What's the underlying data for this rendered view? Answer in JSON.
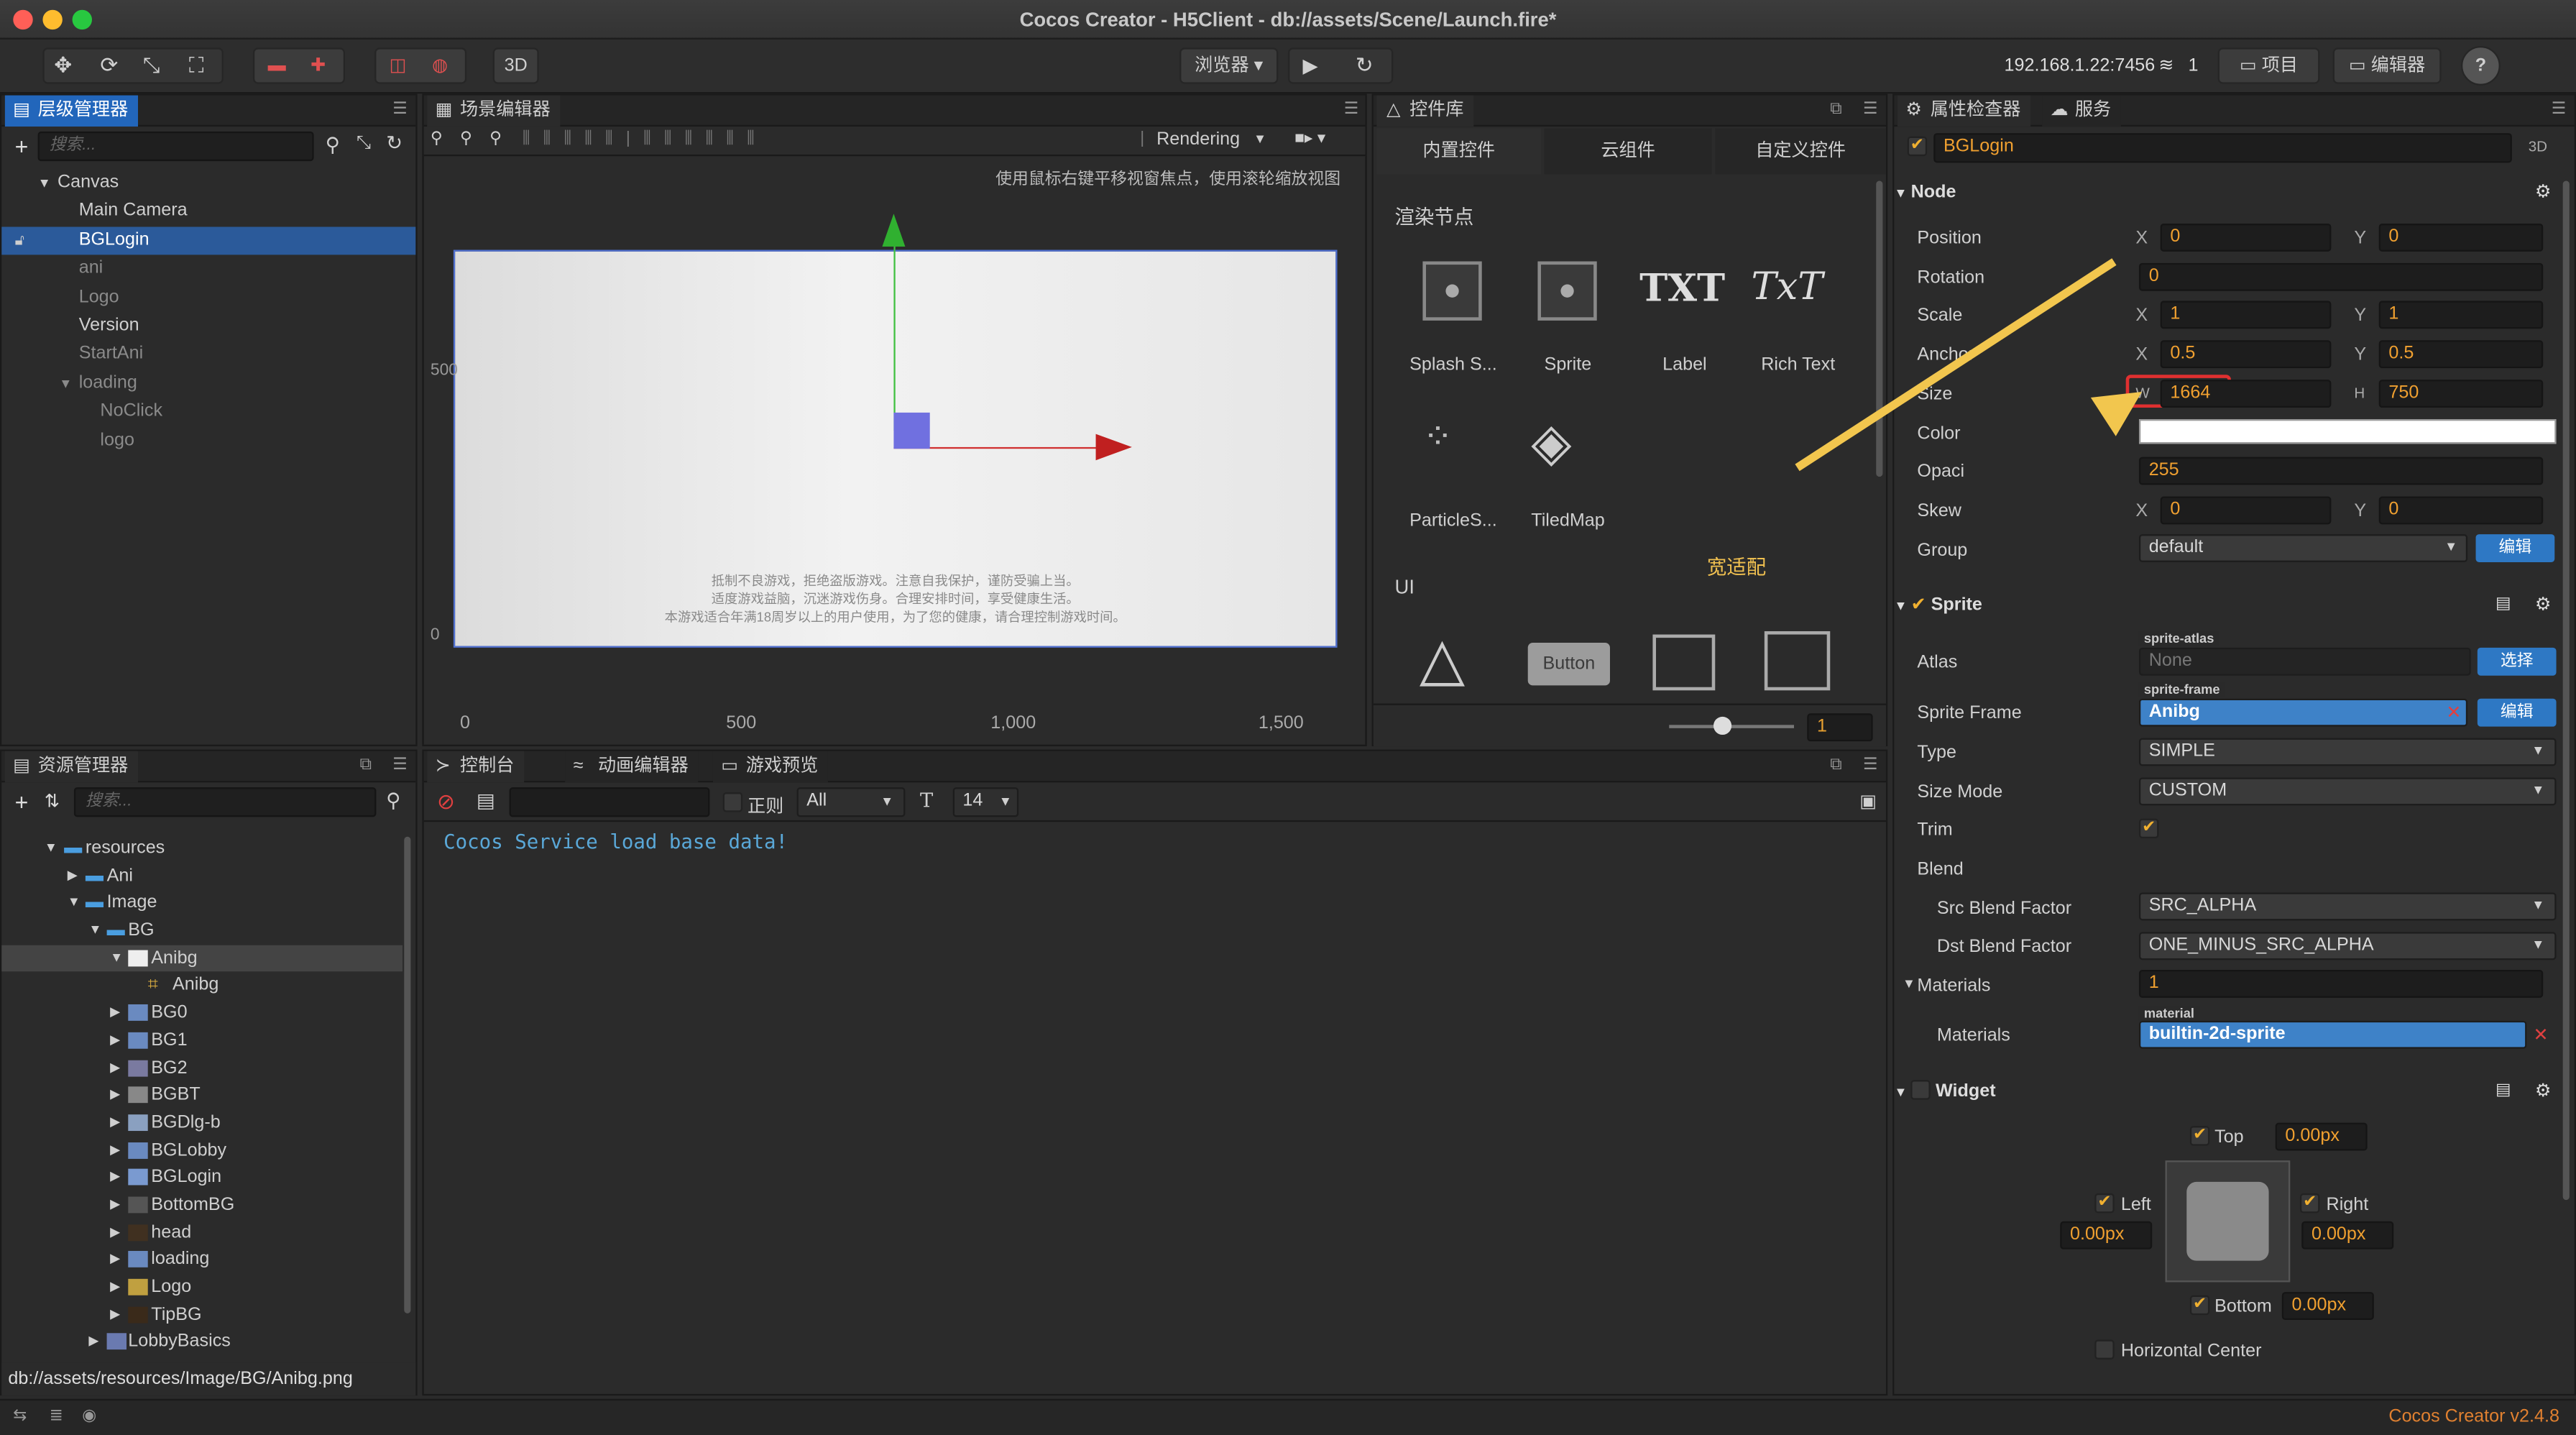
{
  "window": {
    "title": "Cocos Creator - H5Client - db://assets/Scene/Launch.fire*"
  },
  "toolbar": {
    "ip": "192.168.1.22:7456",
    "count": "1",
    "browser": "浏览器 ▾",
    "project": "项目",
    "editor": "编辑器",
    "btn_3d": "3D",
    "help": "?"
  },
  "hierarchy": {
    "tab": "层级管理器",
    "search_placeholder": "搜索...",
    "nodes": [
      "Canvas",
      "Main Camera",
      "BGLogin",
      "ani",
      "Logo",
      "Version",
      "StartAni",
      "loading",
      "NoClick",
      "logo"
    ]
  },
  "scene": {
    "tab": "场景编辑器",
    "rendering": "Rendering",
    "hint": "使用鼠标右键平移视窗焦点，使用滚轮缩放视图",
    "y500": "500",
    "y0": "0",
    "x_ticks": [
      "0",
      "500",
      "1,000",
      "1,500"
    ],
    "canvas_text": [
      "抵制不良游戏，拒绝盗版游戏。注意自我保护，谨防受骗上当。",
      "适度游戏益脑，沉迷游戏伤身。合理安排时间，享受健康生活。",
      "本游戏适合年满18周岁以上的用户使用，为了您的健康，请合理控制游戏时间。"
    ]
  },
  "library": {
    "tab": "控件库",
    "tabs": [
      "内置控件",
      "云组件",
      "自定义控件"
    ],
    "section1": "渲染节点",
    "section2": "UI",
    "items": [
      "Splash S...",
      "Sprite",
      "Label",
      "Rich Text",
      "ParticleS...",
      "TiledMap"
    ],
    "label_glyph": "TXT",
    "richtext_glyph": "TxT",
    "button_glyph": "Button",
    "annotation": "宽适配",
    "zoom": "1"
  },
  "assets": {
    "tab": "资源管理器",
    "search_placeholder": "搜索...",
    "items": [
      "resources",
      "Ani",
      "Image",
      "BG",
      "Anibg",
      "Anibg",
      "BG0",
      "BG1",
      "BG2",
      "BGBT",
      "BGDlg-b",
      "BGLobby",
      "BGLogin",
      "BottomBG",
      "head",
      "loading",
      "Logo",
      "TipBG",
      "LobbyBasics"
    ],
    "path": "db://assets/resources/Image/BG/Anibg.png"
  },
  "console": {
    "tabs": [
      "控制台",
      "动画编辑器",
      "游戏预览"
    ],
    "regex": "正则",
    "filter": "All",
    "font_size": "14",
    "log": "Cocos Service load base data!"
  },
  "inspector": {
    "tabs": [
      "属性检查器",
      "服务"
    ],
    "btn3d": "3D",
    "node_name": "BGLogin",
    "node_section": "Node",
    "position": {
      "label": "Position",
      "x": "0",
      "y": "0"
    },
    "rotation": {
      "label": "Rotation",
      "v": "0"
    },
    "scale": {
      "label": "Scale",
      "x": "1",
      "y": "1"
    },
    "anchor": {
      "label": "Anchor",
      "x": "0.5",
      "y": "0.5"
    },
    "size": {
      "label": "Size",
      "w": "1664",
      "h": "750"
    },
    "color_label": "Color",
    "opacity": {
      "label": "Opaci",
      "v": "255"
    },
    "skew": {
      "label": "Skew",
      "x": "0",
      "y": "0"
    },
    "group": {
      "label": "Group",
      "v": "default",
      "btn": "编辑"
    },
    "sprite_section": "Sprite",
    "atlas": {
      "label": "Atlas",
      "tag": "sprite-atlas",
      "v": "None",
      "btn": "选择"
    },
    "frame": {
      "label": "Sprite Frame",
      "tag": "sprite-frame",
      "v": "Anibg",
      "btn": "编辑"
    },
    "type": {
      "label": "Type",
      "v": "SIMPLE"
    },
    "sizemode": {
      "label": "Size Mode",
      "v": "CUSTOM"
    },
    "trim": "Trim",
    "blend": "Blend",
    "src": {
      "label": "Src Blend Factor",
      "v": "SRC_ALPHA"
    },
    "dst": {
      "label": "Dst Blend Factor",
      "v": "ONE_MINUS_SRC_ALPHA"
    },
    "materials": {
      "label": "Materials",
      "count": "1",
      "tag": "material",
      "item_label": "Materials",
      "v": "builtin-2d-sprite"
    },
    "widget_section": "Widget",
    "widget": {
      "top": "Top",
      "top_v": "0.00px",
      "left": "Left",
      "left_v": "0.00px",
      "right": "Right",
      "right_v": "0.00px",
      "bottom": "Bottom",
      "bottom_v": "0.00px",
      "hcenter": "Horizontal Center"
    }
  },
  "statusbar": {
    "version": "Cocos Creator v2.4.8"
  },
  "labels": {
    "x": "X",
    "y": "Y",
    "w": "W",
    "h": "H"
  }
}
